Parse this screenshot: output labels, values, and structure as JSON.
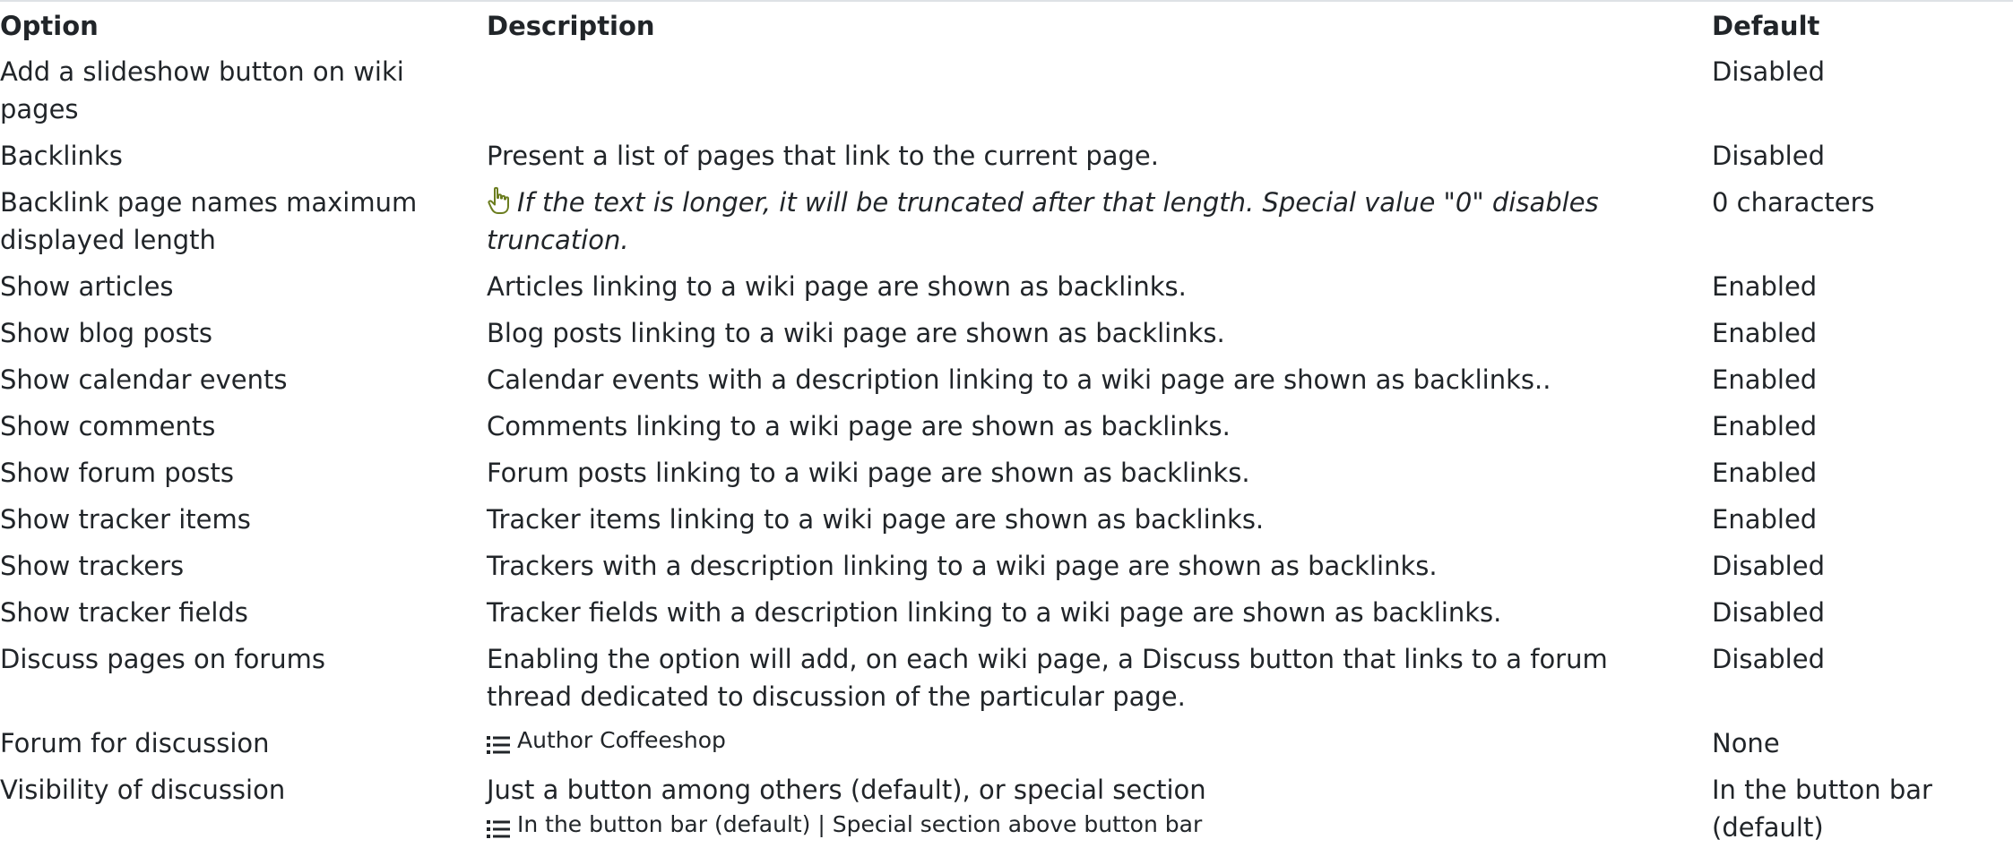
{
  "table": {
    "headers": {
      "option": "Option",
      "description": "Description",
      "default": "Default"
    },
    "rows": [
      {
        "option": "Add a slideshow button on wiki pages",
        "description": "",
        "default": "Disabled"
      },
      {
        "option": "Backlinks",
        "description": "Present a list of pages that link to the current page.",
        "default": "Disabled"
      },
      {
        "option": "Backlink page names maximum displayed length",
        "description": "If the text is longer, it will be truncated after that length. Special value \"0\" disables truncation.",
        "default": "0 characters"
      },
      {
        "option": "Show articles",
        "description": "Articles linking to a wiki page are shown as backlinks.",
        "default": "Enabled"
      },
      {
        "option": "Show blog posts",
        "description": "Blog posts linking to a wiki page are shown as backlinks.",
        "default": "Enabled"
      },
      {
        "option": "Show calendar events",
        "description": "Calendar events with a description linking to a wiki page are shown as backlinks..",
        "default": "Enabled"
      },
      {
        "option": "Show comments",
        "description": "Comments linking to a wiki page are shown as backlinks.",
        "default": "Enabled"
      },
      {
        "option": "Show forum posts",
        "description": "Forum posts linking to a wiki page are shown as backlinks.",
        "default": "Enabled"
      },
      {
        "option": "Show tracker items",
        "description": "Tracker items linking to a wiki page are shown as backlinks.",
        "default": "Enabled"
      },
      {
        "option": "Show trackers",
        "description": "Trackers with a description linking to a wiki page are shown as backlinks.",
        "default": "Disabled"
      },
      {
        "option": "Show tracker fields",
        "description": "Tracker fields with a description linking to a wiki page are shown as backlinks.",
        "default": "Disabled"
      },
      {
        "option": "Discuss pages on forums",
        "description": "Enabling the option will add, on each wiki page, a Discuss button that links to a forum thread dedicated to discussion of the particular page.",
        "default": "Disabled"
      },
      {
        "option": "Forum for discussion",
        "description": "",
        "options_list": "Author Coffeeshop",
        "default": "None"
      },
      {
        "option": "Visibility of discussion",
        "description": "Just a button among others (default), or special section",
        "options_list": "In the button bar (default) | Special section above button bar",
        "default": "In the button bar (default)"
      }
    ]
  },
  "icons": {
    "hand": "pointing-hand-icon",
    "list": "list-icon",
    "hand_color": "#6b7d1f"
  }
}
